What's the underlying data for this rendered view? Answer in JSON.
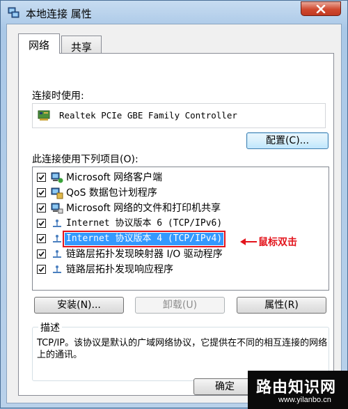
{
  "window": {
    "title": "本地连接 属性"
  },
  "tabs": [
    {
      "label": "网络",
      "active": true
    },
    {
      "label": "共享",
      "active": false
    }
  ],
  "connect_using": {
    "label": "连接时使用:",
    "adapter": "Realtek PCIe GBE Family Controller",
    "configure_button": "配置(C)..."
  },
  "items_section": {
    "label": "此连接使用下列项目(O):",
    "items": [
      {
        "label": "Microsoft 网络客户端",
        "checked": true,
        "icon": "network-client-icon"
      },
      {
        "label": "QoS 数据包计划程序",
        "checked": true,
        "icon": "qos-scheduler-icon"
      },
      {
        "label": "Microsoft 网络的文件和打印机共享",
        "checked": true,
        "icon": "file-printer-sharing-icon"
      },
      {
        "label": "Internet 协议版本 6 (TCP/IPv6)",
        "checked": true,
        "icon": "protocol-icon"
      },
      {
        "label": "Internet 协议版本 4 (TCP/IPv4)",
        "checked": true,
        "icon": "protocol-icon",
        "selected": true
      },
      {
        "label": "链路层拓扑发现映射器 I/O 驱动程序",
        "checked": true,
        "icon": "protocol-icon"
      },
      {
        "label": "链路层拓扑发现响应程序",
        "checked": true,
        "icon": "protocol-icon"
      }
    ]
  },
  "annotation": {
    "text": "鼠标双击",
    "color": "#e3141c"
  },
  "buttons": {
    "install": "安装(N)...",
    "uninstall": "卸载(U)",
    "properties": "属性(R)",
    "ok": "确定"
  },
  "description": {
    "title": "描述",
    "text": "TCP/IP。该协议是默认的广域网络协议，它提供在不同的相互连接的网络上的通讯。"
  },
  "watermark": {
    "main": "路由知识网",
    "sub": "www.yilanbo.cn"
  },
  "colors": {
    "selection": "#3399ff",
    "annotation_red": "#e3141c",
    "close_button": "#c94a31"
  }
}
